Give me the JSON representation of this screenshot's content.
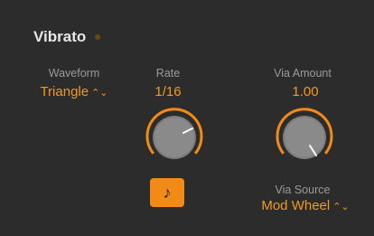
{
  "section": {
    "title": "Vibrato"
  },
  "waveform": {
    "label": "Waveform",
    "value": "Triangle"
  },
  "rate": {
    "label": "Rate",
    "value": "1/16"
  },
  "via_amount": {
    "label": "Via Amount",
    "value": "1.00"
  },
  "via_source": {
    "label": "Via Source",
    "value": "Mod Wheel"
  },
  "note_sync_button": {
    "icon": "eighth-note-icon",
    "glyph": "♪"
  },
  "chevron_glyph": "⌃⌄",
  "colors": {
    "accent": "#f39a1c",
    "background": "#2c2c2c",
    "label": "#9a9a9a"
  }
}
